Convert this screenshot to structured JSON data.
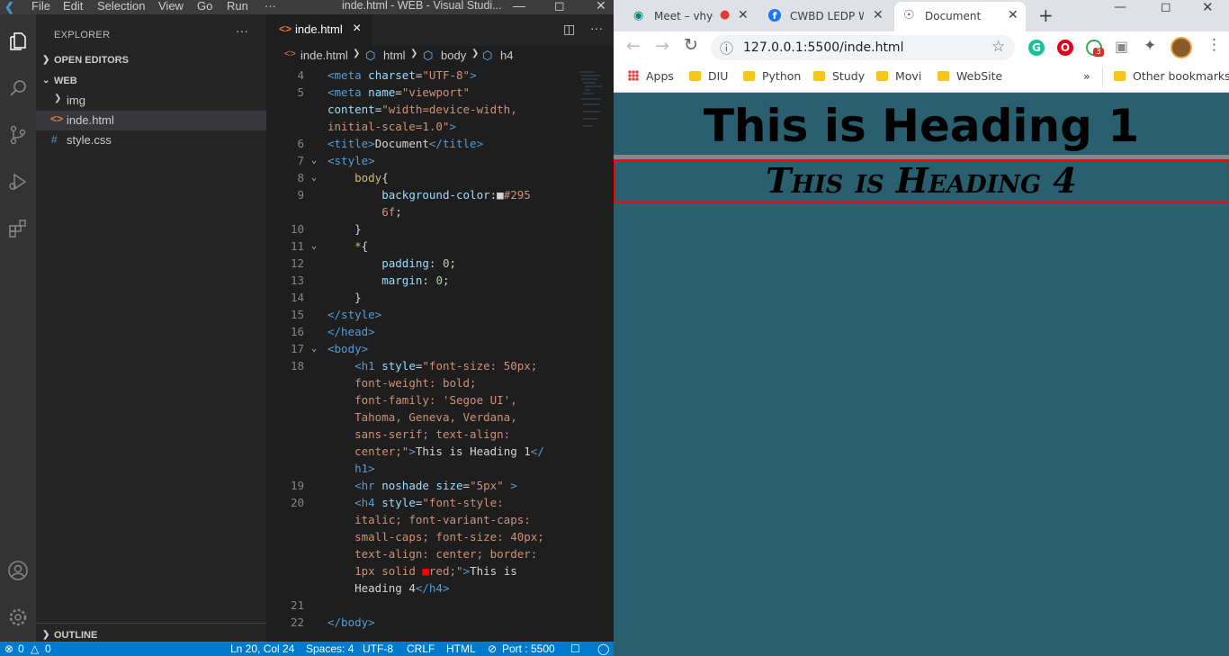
{
  "vscode": {
    "menu": [
      "File",
      "Edit",
      "Selection",
      "View",
      "Go",
      "Run",
      "···"
    ],
    "window_title": "inde.html - WEB - Visual Studi...",
    "explorer_title": "EXPLORER",
    "sections": {
      "open_editors": "OPEN EDITORS",
      "web": "WEB",
      "outline": "OUTLINE"
    },
    "tree": [
      {
        "icon": "folder-chevron",
        "label": "img"
      },
      {
        "icon": "html-icon",
        "label": "inde.html"
      },
      {
        "icon": "css-icon",
        "label": "style.css"
      }
    ],
    "tab": {
      "label": "inde.html",
      "close": "×"
    },
    "breadcrumb": [
      "inde.html",
      "html",
      "body",
      "h4"
    ],
    "code_lines": [
      {
        "num": "4",
        "html": "<span class='t'>&lt;meta</span> <span class='a'>charset</span><span class='w'>=</span><span class='s'>\"UTF-8\"</span><span class='t'>&gt;</span>"
      },
      {
        "num": "5",
        "html": "<span class='t'>&lt;meta</span> <span class='a'>name</span><span class='w'>=</span><span class='s'>\"viewport\"</span>"
      },
      {
        "num": "",
        "html": "<span class='a'>content</span><span class='w'>=</span><span class='s'>\"width=device-width,</span>"
      },
      {
        "num": "",
        "html": "<span class='s'>initial-scale=1.0\"</span><span class='t'>&gt;</span>"
      },
      {
        "num": "6",
        "html": "<span class='t'>&lt;title&gt;</span><span class='w'>Document</span><span class='t'>&lt;/title&gt;</span>"
      },
      {
        "num": "7",
        "html": "<span class='t'>&lt;style&gt;</span>"
      },
      {
        "num": "8",
        "html": "    <span class='y'>body</span><span class='w'>{</span>"
      },
      {
        "num": "9",
        "html": "        <span class='a'>background-color</span><span class='w'>:</span>&#9632;<span class='s'>#295</span>"
      },
      {
        "num": "",
        "html": "        <span class='s'>6f</span><span class='w'>;</span>"
      },
      {
        "num": "10",
        "html": "    <span class='w'>}</span>"
      },
      {
        "num": "11",
        "html": "    <span class='y'>*</span><span class='w'>{</span>"
      },
      {
        "num": "12",
        "html": "        <span class='a'>padding</span><span class='w'>: </span><span class='n'>0</span><span class='w'>;</span>"
      },
      {
        "num": "13",
        "html": "        <span class='a'>margin</span><span class='w'>: </span><span class='n'>0</span><span class='w'>;</span>"
      },
      {
        "num": "14",
        "html": "    <span class='w'>}</span>"
      },
      {
        "num": "15",
        "html": "<span class='t'>&lt;/style&gt;</span>"
      },
      {
        "num": "16",
        "html": "<span class='t'>&lt;/head&gt;</span>"
      },
      {
        "num": "17",
        "html": "<span class='t'>&lt;body&gt;</span>"
      },
      {
        "num": "18",
        "html": "    <span class='t'>&lt;h1</span> <span class='a'>style</span><span class='w'>=</span><span class='s'>\"font-size: 50px;</span>"
      },
      {
        "num": "",
        "html": "    <span class='s'>font-weight: bold;</span>"
      },
      {
        "num": "",
        "html": "    <span class='s'>font-family: 'Segoe UI',</span>"
      },
      {
        "num": "",
        "html": "    <span class='s'>Tahoma, Geneva, Verdana,</span>"
      },
      {
        "num": "",
        "html": "    <span class='s'>sans-serif; text-align:</span>"
      },
      {
        "num": "",
        "html": "    <span class='s'>center;\"</span><span class='t'>&gt;</span><span class='w'>This is Heading 1</span><span class='t'>&lt;/</span>"
      },
      {
        "num": "",
        "html": "    <span class='t'>h1&gt;</span>"
      },
      {
        "num": "19",
        "html": "    <span class='t'>&lt;hr</span> <span class='a'>noshade</span> <span class='a'>size</span><span class='w'>=</span><span class='s'>\"5px\"</span> <span class='t'>&gt;</span>"
      },
      {
        "num": "20",
        "html": "    <span class='t'>&lt;h4</span> <span class='a'>style</span><span class='w'>=</span><span class='s'>\"font-style:</span>"
      },
      {
        "num": "",
        "html": "    <span class='s'>italic; font-variant-caps:</span>"
      },
      {
        "num": "",
        "html": "    <span class='s'>small-caps; font-size: 40px;</span>"
      },
      {
        "num": "",
        "html": "    <span class='s'>text-align: center; border:</span>"
      },
      {
        "num": "",
        "html": "    <span class='s'>1px solid </span><span style='color:#f00'>&#9632;</span><span class='s'>red;\"</span><span class='t'>&gt;</span><span class='w'>This is</span>"
      },
      {
        "num": "",
        "html": "    <span class='w'>Heading 4</span><span class='t'>&lt;/h4&gt;</span>"
      },
      {
        "num": "21",
        "html": ""
      },
      {
        "num": "22",
        "html": "<span class='t'>&lt;/body&gt;</span>"
      }
    ],
    "status": {
      "errors": "0",
      "warnings": "0",
      "position": "Ln 20, Col 24",
      "spaces": "Spaces: 4",
      "encoding": "UTF-8",
      "eol": "CRLF",
      "language": "HTML",
      "port": "Port : 5500"
    }
  },
  "chrome": {
    "tabs": [
      {
        "title": "Meet – vhy-",
        "icon": "meet-icon"
      },
      {
        "title": "CWBD LEDP WD",
        "icon": "facebook-icon"
      },
      {
        "title": "Document",
        "icon": "globe-icon"
      }
    ],
    "url": "127.0.0.1:5500/inde.html",
    "extension_badge": "3",
    "bookmarks": [
      "Apps",
      "DIU",
      "Python",
      "Study",
      "Movi",
      "WebSite"
    ],
    "other_bookmarks": "Other bookmarks",
    "page": {
      "h1": "This is Heading 1",
      "h4": "This is Heading 4",
      "background": "#295f6f"
    }
  }
}
